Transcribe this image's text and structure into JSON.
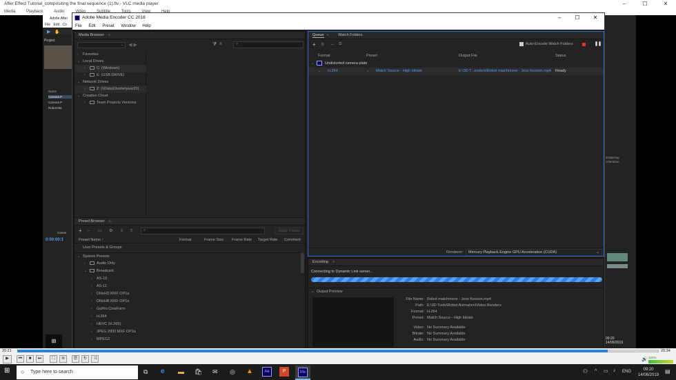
{
  "vlc": {
    "title": "After Effect Tutorial_compositing the final  sequence (1).flv - VLC media player",
    "menu": [
      "Media",
      "Playback",
      "Audio",
      "Video",
      "Subtitle",
      "Tools",
      "View",
      "Help"
    ],
    "time_current": "20:21",
    "time_total": "20:34",
    "volume": "121%",
    "progress": 0.92
  },
  "ae": {
    "title": "Adobe After",
    "menu": [
      "File",
      "Edit",
      "Co"
    ],
    "project_tab": "Project",
    "col_name": "Name",
    "items": [
      "Camera P",
      "Camera P",
      "Robot Ma"
    ],
    "timecode": "0:00:00:1",
    "layer": "Camer",
    "status_lines": [
      "initializing",
      "celeration"
    ],
    "clock": "09:20",
    "date": "14/06/2019"
  },
  "ame": {
    "title": "Adobe Media Encoder CC 2018",
    "menu": [
      "File",
      "Edit",
      "Preset",
      "Window",
      "Help"
    ],
    "media_browser": {
      "tab": "Media Browser",
      "tree": [
        {
          "label": "Favorites",
          "level": 0
        },
        {
          "label": "Local Drives",
          "level": 0
        },
        {
          "label": "C: (Windows)",
          "level": 1
        },
        {
          "label": "E: (USB DRIVE)",
          "level": 1
        },
        {
          "label": "Network Drives",
          "level": 0
        },
        {
          "label": "Z: (\\\\Data1\\home\\year20(",
          "level": 1
        },
        {
          "label": "Creative Cloud",
          "level": 0
        },
        {
          "label": "Team Projects Versions",
          "level": 1
        }
      ]
    },
    "queue": {
      "tabs": [
        "Queue",
        "Watch Folders"
      ],
      "auto_encode": "Auto-Encode Watch Folders",
      "cols": [
        "Format",
        "Preset",
        "Output File",
        "Status"
      ],
      "group": "Undistorted camera plate",
      "item": {
        "format": "H.264",
        "preset": "Match Source - High bitrate",
        "output": "E:\\3D T...enders\\Robot matchmove - Jess Kesson.mp4",
        "status": "Ready"
      },
      "renderer_label": "Renderer:",
      "renderer": "Mercury Playback Engine GPU Acceleration (CUDA)"
    },
    "preset_browser": {
      "tab": "Preset Browser",
      "apply": "Apply Preset",
      "cols": [
        "Preset Name",
        "Format",
        "Frame Size",
        "Frame Rate",
        "Target Rate",
        "Comment"
      ],
      "user_group": "User Presets & Groups",
      "system_group": "System Presets",
      "items": [
        "Audio Only",
        "Broadcast",
        "AS-10",
        "AS-11",
        "DNxHD MXF OP1a",
        "DNxHR MXF OP1a",
        "GoPro CineForm",
        "H.264",
        "HEVC (H.265)",
        "JPEG 2000 MXF OP1a",
        "MPEG2"
      ]
    },
    "encoding": {
      "tab": "Encoding",
      "status": "Connecting to Dynamic Link server...",
      "output_preview": "Output Preview",
      "fields": [
        {
          "k": "File Name:",
          "v": "Robot matchmove - Jess Kesson.mp4"
        },
        {
          "k": "Path:",
          "v": "E:\\3D Tools\\Robot Animation\\Video Renders"
        },
        {
          "k": "Format:",
          "v": "H.264"
        },
        {
          "k": "Preset:",
          "v": "Match Source - High bitrate"
        },
        {
          "k": "Video:",
          "v": "No Summary Available"
        },
        {
          "k": "Bitrate:",
          "v": "No Summary Available"
        },
        {
          "k": "Audio:",
          "v": "No Summary Available"
        }
      ]
    }
  },
  "taskbar": {
    "search": "Type here to search",
    "lang": "ENG",
    "time": "09:20",
    "date": "14/06/2019"
  }
}
